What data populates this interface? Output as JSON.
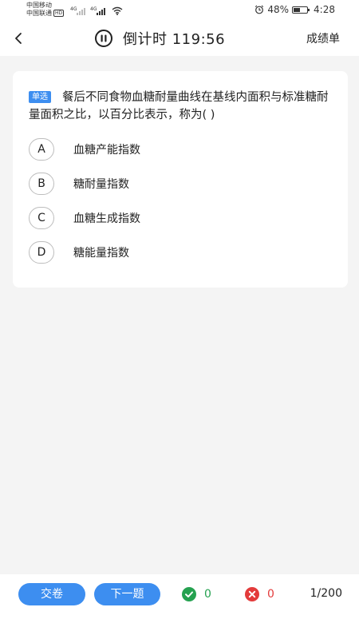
{
  "status_bar": {
    "carrier_1": "中国移动",
    "carrier_2": "中国联通",
    "hd_badge": "HD",
    "network_1": "4G",
    "network_2": "4G",
    "battery_text": "48%",
    "battery_level": 0.48,
    "time": "4:28"
  },
  "header": {
    "title": "倒计时 119:56",
    "report_label": "成绩单",
    "icons": {
      "back": "chevron-left-icon",
      "pause": "pause-icon"
    }
  },
  "question": {
    "type_tag": "单选",
    "text": "餐后不同食物血糖耐量曲线在基线内面积与标准糖耐量面积之比，以百分比表示，称为( )",
    "options": [
      {
        "letter": "A",
        "text": "血糖产能指数"
      },
      {
        "letter": "B",
        "text": "糖耐量指数"
      },
      {
        "letter": "C",
        "text": "血糖生成指数"
      },
      {
        "letter": "D",
        "text": "糖能量指数"
      }
    ]
  },
  "bottom": {
    "submit_label": "交卷",
    "next_label": "下一题",
    "correct_count": "0",
    "wrong_count": "0",
    "progress": "1/200",
    "colors": {
      "accent": "#3d8ef0",
      "correct": "#25a150",
      "wrong": "#e33b3b"
    }
  }
}
